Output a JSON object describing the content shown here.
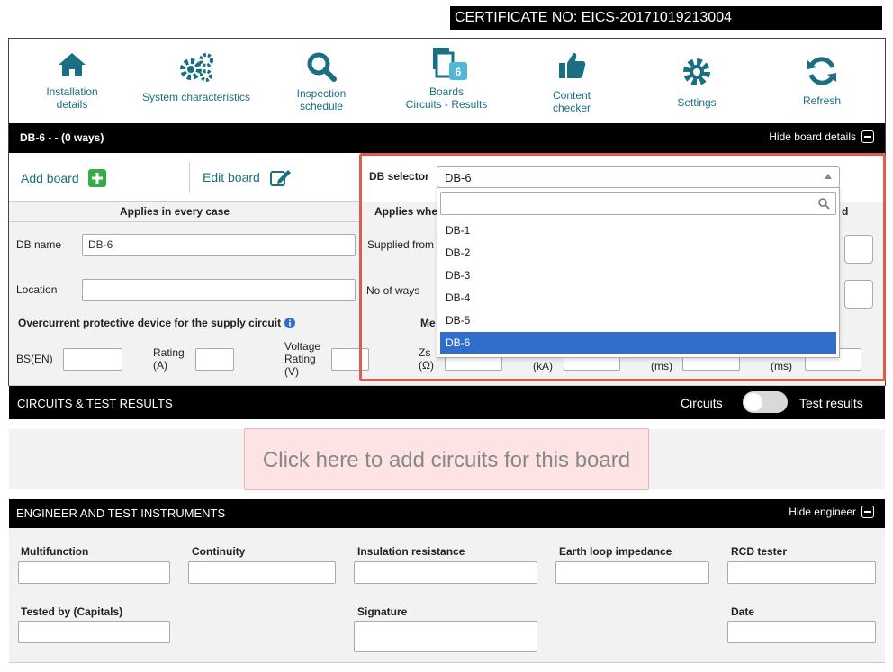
{
  "certificate": "CERTIFICATE NO: EICS-20171019213004",
  "nav": [
    {
      "label": "Installation\ndetails"
    },
    {
      "label": "System characteristics"
    },
    {
      "label": "Inspection\nschedule"
    },
    {
      "label": "Boards\nCircuits - Results",
      "badge": "6"
    },
    {
      "label": "Content\nchecker"
    },
    {
      "label": "Settings"
    },
    {
      "label": "Refresh"
    }
  ],
  "board_bar": {
    "title": "DB-6 -  - (0 ways)",
    "hide": "Hide board details"
  },
  "actions": {
    "add": "Add board",
    "edit": "Edit board"
  },
  "db_selector": {
    "label": "DB selector",
    "value": "DB-6",
    "options": [
      "DB-1",
      "DB-2",
      "DB-3",
      "DB-4",
      "DB-5",
      "DB-6"
    ],
    "selected": "DB-6"
  },
  "sections": {
    "every_case": "Applies in every case",
    "applies_when": "Applies whe",
    "right_fragment": "d",
    "overcurrent": "Overcurrent protective device for the supply circuit",
    "measured": "Me"
  },
  "fields": {
    "db_name": "DB name",
    "db_name_value": "DB-6",
    "location": "Location",
    "supplied_from": "Supplied from",
    "no_of_ways": "No of ways",
    "bsen": "BS(EN)",
    "rating": "Rating\n(A)",
    "voltage": "Voltage\nRating\n(V)",
    "zs": "Zs\n(Ω)",
    "ka": "(kA)",
    "ms1": "(ms)",
    "ms2": "(ms)"
  },
  "circuits_bar": {
    "title": "CIRCUITS & TEST RESULTS",
    "circuits": "Circuits",
    "test_results": "Test results"
  },
  "add_circuits": "Click here to add circuits for this board",
  "engineer": {
    "title": "ENGINEER AND TEST INSTRUMENTS",
    "hide": "Hide engineer",
    "multifunction": "Multifunction",
    "continuity": "Continuity",
    "insulation": "Insulation resistance",
    "earth_loop": "Earth loop impedance",
    "rcd": "RCD tester",
    "tested_by": "Tested by (Capitals)",
    "signature": "Signature",
    "date": "Date"
  },
  "colors": {
    "accent": "#1a6f83",
    "selected": "#2f6fcb",
    "highlight": "#e05a4f"
  }
}
